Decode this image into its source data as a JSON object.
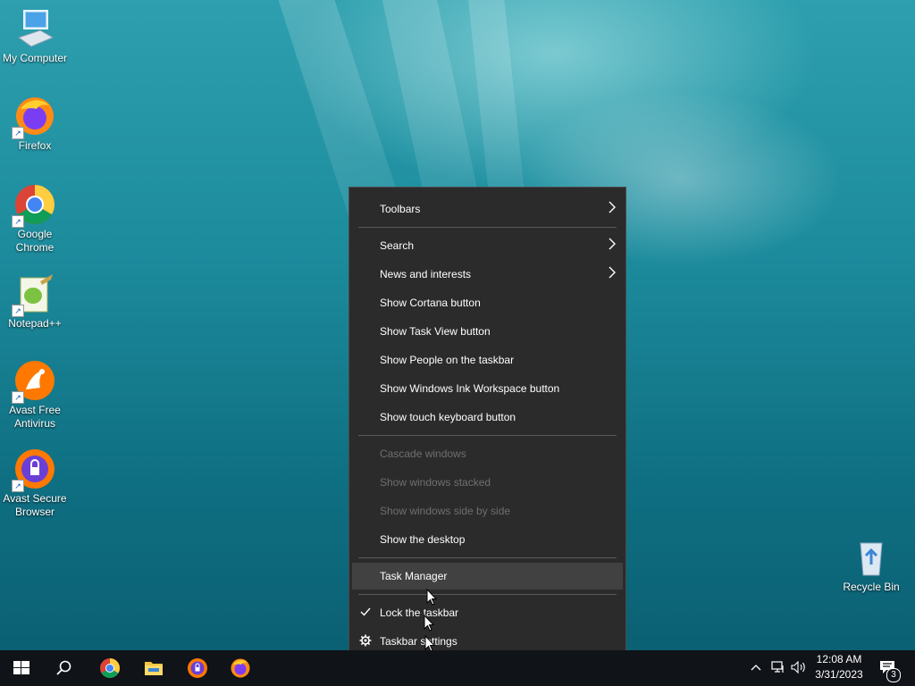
{
  "desktop": {
    "icons": [
      {
        "label": "My Computer",
        "icon": "computer-icon"
      },
      {
        "label": "Firefox",
        "icon": "firefox-icon"
      },
      {
        "label": "Google Chrome",
        "icon": "chrome-icon"
      },
      {
        "label": "Notepad++",
        "icon": "notepadpp-icon"
      },
      {
        "label": "Avast Free Antivirus",
        "icon": "avast-antivirus-icon"
      },
      {
        "label": "Avast Secure Browser",
        "icon": "avast-browser-icon"
      },
      {
        "label": "Recycle Bin",
        "icon": "recycle-bin-icon"
      }
    ]
  },
  "context_menu": {
    "items": [
      {
        "label": "Toolbars",
        "submenu": true
      },
      {
        "label": "Search",
        "submenu": true
      },
      {
        "label": "News and interests",
        "submenu": true
      },
      {
        "label": "Show Cortana button"
      },
      {
        "label": "Show Task View button"
      },
      {
        "label": "Show People on the taskbar"
      },
      {
        "label": "Show Windows Ink Workspace button"
      },
      {
        "label": "Show touch keyboard button"
      },
      {
        "label": "Cascade windows",
        "disabled": true
      },
      {
        "label": "Show windows stacked",
        "disabled": true
      },
      {
        "label": "Show windows side by side",
        "disabled": true
      },
      {
        "label": "Show the desktop"
      },
      {
        "label": "Task Manager",
        "highlighted": true
      },
      {
        "label": "Lock the taskbar",
        "checked": true
      },
      {
        "label": "Taskbar settings",
        "icon": "gear-icon"
      }
    ]
  },
  "taskbar": {
    "buttons": [
      "start-icon",
      "search-icon",
      "chrome-icon",
      "file-explorer-icon",
      "avast-browser-icon",
      "firefox-icon"
    ],
    "tray": {
      "time": "12:08 AM",
      "date": "3/31/2023",
      "notification_count": "3"
    }
  },
  "colors": {
    "menu_bg": "#2b2b2b",
    "menu_highlight": "#414141",
    "taskbar_bg": "#101318",
    "disabled_text": "#6f6f6f"
  }
}
